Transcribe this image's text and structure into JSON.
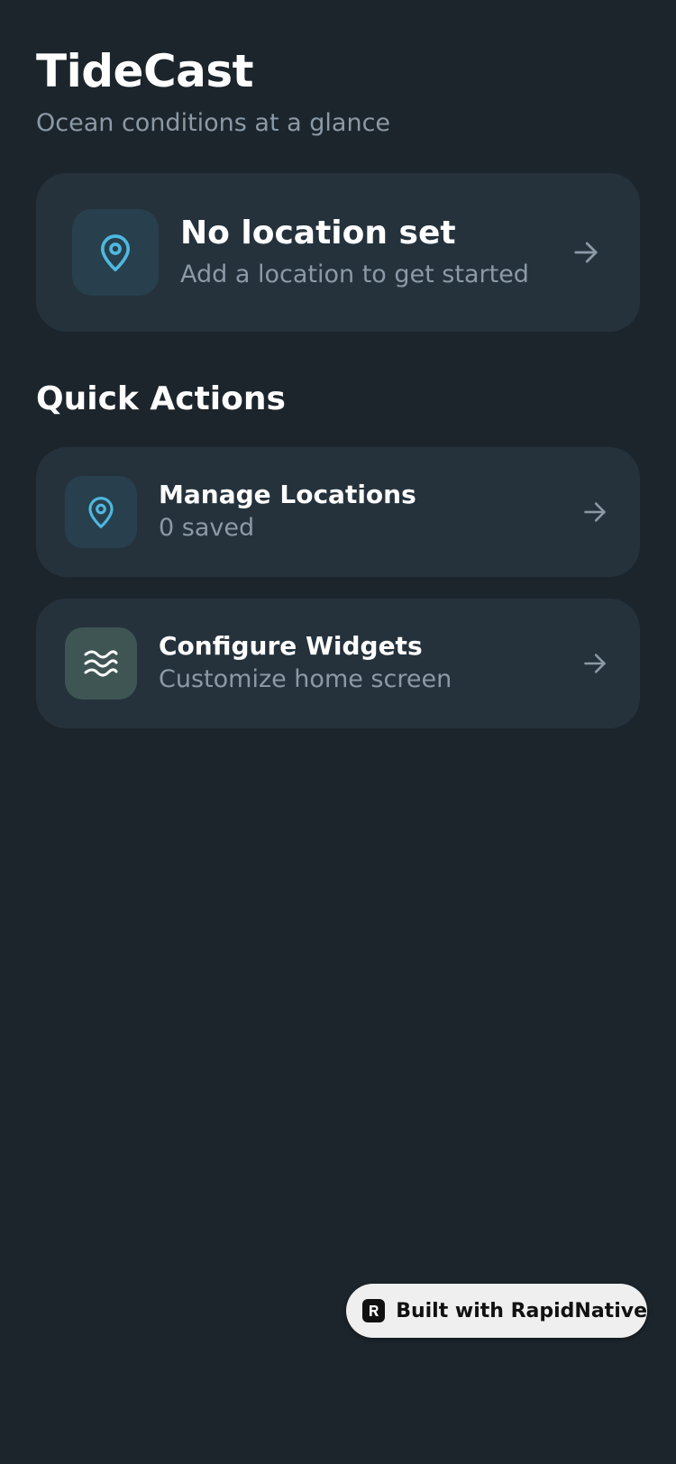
{
  "header": {
    "title": "TideCast",
    "subtitle": "Ocean conditions at a glance"
  },
  "location_card": {
    "icon": "map-pin-icon",
    "title": "No location set",
    "subtitle": "Add a location to get started"
  },
  "quick_actions": {
    "title": "Quick Actions",
    "items": [
      {
        "icon": "map-pin-icon",
        "title": "Manage Locations",
        "subtitle": "0 saved"
      },
      {
        "icon": "waves-icon",
        "title": "Configure Widgets",
        "subtitle": "Customize home screen"
      }
    ]
  },
  "badge": {
    "icon": "rapidnative-logo-icon",
    "label": "Built with RapidNative"
  },
  "colors": {
    "background": "#1c252c",
    "card": "#25323c",
    "accent": "#4fb8e0",
    "muted_text": "#8b9aa6"
  }
}
